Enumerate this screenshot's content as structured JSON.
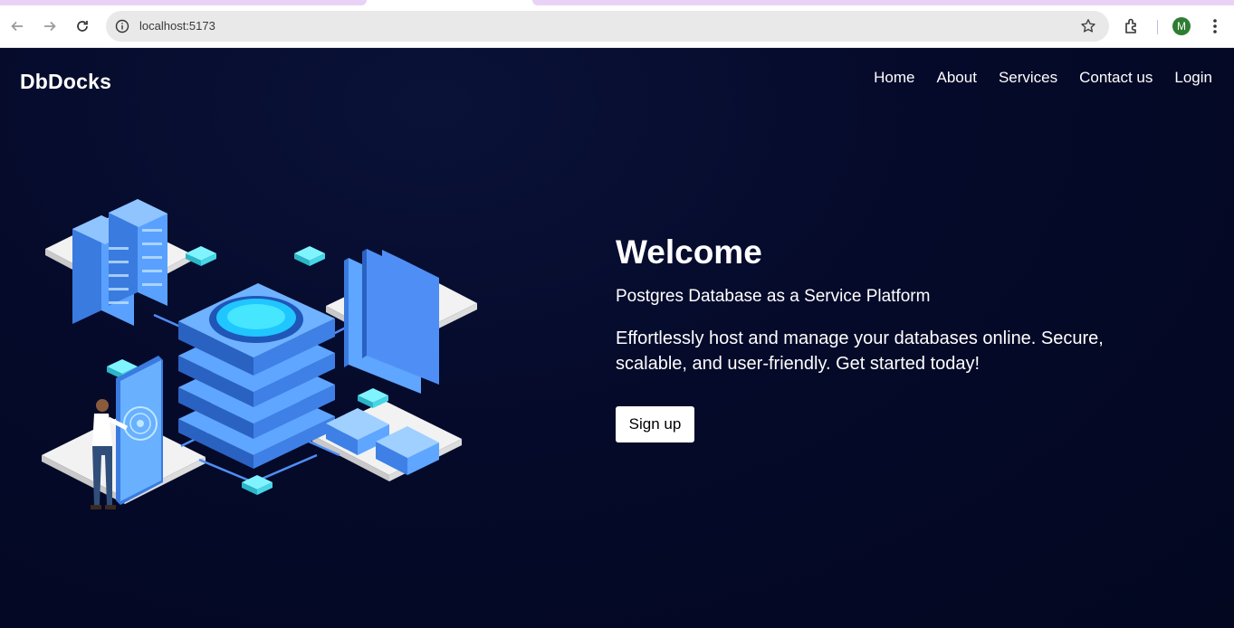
{
  "browser": {
    "url": "localhost:5173",
    "profile_initial": "M",
    "icons": [
      "back-arrow-icon",
      "forward-arrow-icon",
      "reload-icon",
      "info-icon",
      "star-icon",
      "extensions-icon",
      "more-menu-icon"
    ]
  },
  "site": {
    "brand": "DbDocks",
    "nav": [
      {
        "label": "Home"
      },
      {
        "label": "About"
      },
      {
        "label": "Services"
      },
      {
        "label": "Contact us"
      },
      {
        "label": "Login"
      }
    ]
  },
  "hero": {
    "title": "Welcome",
    "subtitle": "Postgres Database as a Service Platform",
    "description": "Effortlessly host and manage your databases online. Secure, scalable, and user-friendly. Get started today!",
    "cta_label": "Sign up"
  },
  "colors": {
    "page_background": "#050a2a",
    "accent_blue": "#4f8ff5",
    "accent_cyan": "#46e6ff",
    "avatar_green": "#2e7d32"
  }
}
